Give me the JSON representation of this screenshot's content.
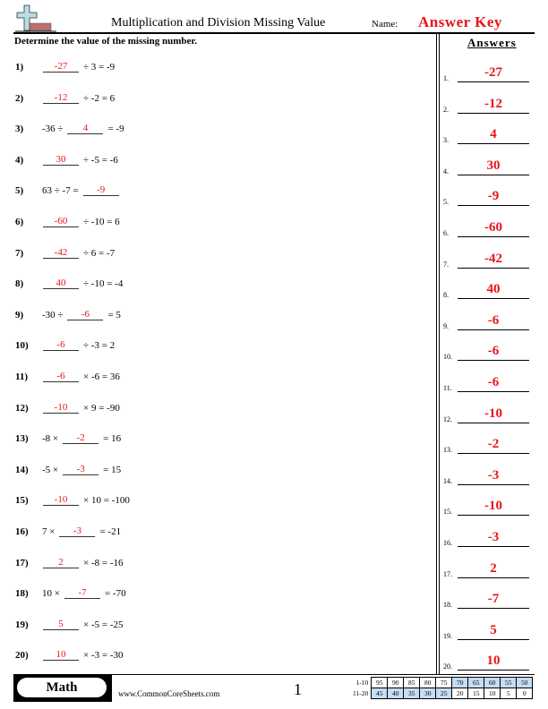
{
  "header": {
    "title": "Multiplication and Division Missing Value",
    "name_label": "Name:",
    "name_value": "Answer Key",
    "instructions": "Determine the value of the missing number."
  },
  "answers_panel": {
    "title": "Answers"
  },
  "colors": {
    "answer_red": "#e8141a",
    "score_highlight": "#c7dcf5"
  },
  "questions": [
    {
      "num": "1)",
      "before": "",
      "answer": "-27",
      "after": "÷ 3 = -9"
    },
    {
      "num": "2)",
      "before": "",
      "answer": "-12",
      "after": "÷ -2 = 6"
    },
    {
      "num": "3)",
      "before": "-36 ÷",
      "answer": "4",
      "after": "= -9"
    },
    {
      "num": "4)",
      "before": "",
      "answer": "30",
      "after": "÷ -5 = -6"
    },
    {
      "num": "5)",
      "before": "63 ÷ -7 =",
      "answer": "-9",
      "after": ""
    },
    {
      "num": "6)",
      "before": "",
      "answer": "-60",
      "after": "÷ -10 = 6"
    },
    {
      "num": "7)",
      "before": "",
      "answer": "-42",
      "after": "÷ 6 = -7"
    },
    {
      "num": "8)",
      "before": "",
      "answer": "40",
      "after": "÷ -10 = -4"
    },
    {
      "num": "9)",
      "before": "-30 ÷",
      "answer": "-6",
      "after": "= 5"
    },
    {
      "num": "10)",
      "before": "",
      "answer": "-6",
      "after": "÷ -3 = 2"
    },
    {
      "num": "11)",
      "before": "",
      "answer": "-6",
      "after": "× -6 = 36"
    },
    {
      "num": "12)",
      "before": "",
      "answer": "-10",
      "after": "× 9 = -90"
    },
    {
      "num": "13)",
      "before": "-8 ×",
      "answer": "-2",
      "after": "= 16"
    },
    {
      "num": "14)",
      "before": "-5 ×",
      "answer": "-3",
      "after": "= 15"
    },
    {
      "num": "15)",
      "before": "",
      "answer": "-10",
      "after": "× 10 = -100"
    },
    {
      "num": "16)",
      "before": "7 ×",
      "answer": "-3",
      "after": "= -21"
    },
    {
      "num": "17)",
      "before": "",
      "answer": "2",
      "after": "× -8 = -16"
    },
    {
      "num": "18)",
      "before": "10 ×",
      "answer": "-7",
      "after": "= -70"
    },
    {
      "num": "19)",
      "before": "",
      "answer": "5",
      "after": "× -5 = -25"
    },
    {
      "num": "20)",
      "before": "",
      "answer": "10",
      "after": "× -3 = -30"
    }
  ],
  "answer_key": [
    {
      "num": "1.",
      "value": "-27"
    },
    {
      "num": "2.",
      "value": "-12"
    },
    {
      "num": "3.",
      "value": "4"
    },
    {
      "num": "4.",
      "value": "30"
    },
    {
      "num": "5.",
      "value": "-9"
    },
    {
      "num": "6.",
      "value": "-60"
    },
    {
      "num": "7.",
      "value": "-42"
    },
    {
      "num": "8.",
      "value": "40"
    },
    {
      "num": "9.",
      "value": "-6"
    },
    {
      "num": "10.",
      "value": "-6"
    },
    {
      "num": "11.",
      "value": "-6"
    },
    {
      "num": "12.",
      "value": "-10"
    },
    {
      "num": "13.",
      "value": "-2"
    },
    {
      "num": "14.",
      "value": "-3"
    },
    {
      "num": "15.",
      "value": "-10"
    },
    {
      "num": "16.",
      "value": "-3"
    },
    {
      "num": "17.",
      "value": "2"
    },
    {
      "num": "18.",
      "value": "-7"
    },
    {
      "num": "19.",
      "value": "5"
    },
    {
      "num": "20.",
      "value": "10"
    }
  ],
  "footer": {
    "subject": "Math",
    "site": "www.CommonCoreSheets.com",
    "page": "1",
    "score_rows": [
      {
        "label": "1-10",
        "values": [
          "95",
          "90",
          "85",
          "80",
          "75",
          "70",
          "65",
          "60",
          "55",
          "50"
        ],
        "highlight": [
          false,
          false,
          false,
          false,
          false,
          true,
          true,
          true,
          true,
          true
        ]
      },
      {
        "label": "11-20",
        "values": [
          "45",
          "40",
          "35",
          "30",
          "25",
          "20",
          "15",
          "10",
          "5",
          "0"
        ],
        "highlight": [
          true,
          true,
          true,
          true,
          true,
          false,
          false,
          false,
          false,
          false
        ]
      }
    ]
  }
}
